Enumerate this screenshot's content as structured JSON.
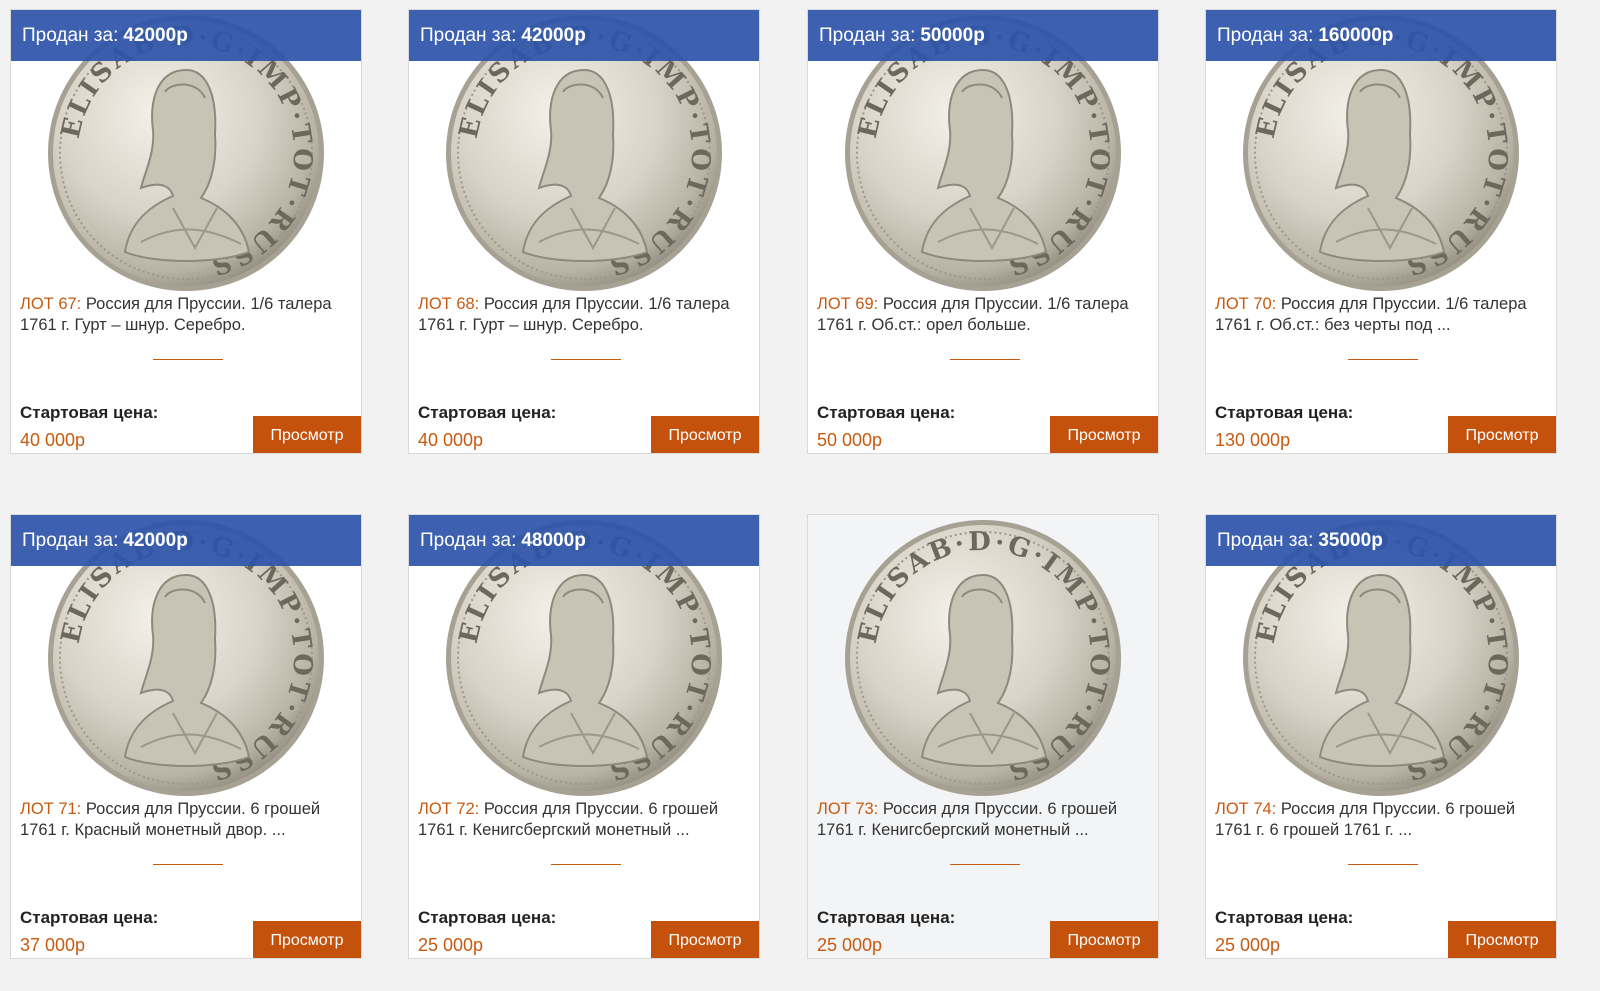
{
  "sold_prefix": "Продан за:",
  "start_label": "Стартовая цена:",
  "view_label": "Просмотр",
  "colors": {
    "sold_bar": "#2e55aa",
    "accent": "#c75a10",
    "button": "#c4510c"
  },
  "lots": [
    {
      "sold_price": "42000р",
      "lot_label": "ЛОТ 67:",
      "description": "Россия для Пруссии. 1/6 талера 1761 г. Гурт – шнур. Серебро.",
      "start_price": "40 000р",
      "coin_legend": "ELISAB·D·G·IMP·TOT·RUSS"
    },
    {
      "sold_price": "42000р",
      "lot_label": "ЛОТ 68:",
      "description": "Россия для Пруссии. 1/6 талера 1761 г. Гурт – шнур. Серебро.",
      "start_price": "40 000р",
      "coin_legend": "ELISAB·D·G·IMP·TOT·RUSS"
    },
    {
      "sold_price": "50000р",
      "lot_label": "ЛОТ 69:",
      "description": "Россия для Пруссии. 1/6 талера 1761 г. Об.ст.: орел больше.",
      "start_price": "50 000р",
      "coin_legend": "ELISAB·D·G·IMP·TOT·RUSS"
    },
    {
      "sold_price": "160000р",
      "lot_label": "ЛОТ 70:",
      "description": "Россия для Пруссии. 1/6 талера 1761 г. Об.ст.: без черты под ...",
      "start_price": "130 000р",
      "coin_legend": "ELISAB·D·G·IMP·TOT·RUSS"
    },
    {
      "sold_price": "42000р",
      "lot_label": "ЛОТ 71:",
      "description": "Россия для Пруссии. 6 грошей 1761 г. Красный монетный двор. ...",
      "start_price": "37 000р",
      "coin_legend": "ELISAB·D·G·IMP·TOT·RUSS"
    },
    {
      "sold_price": "48000р",
      "lot_label": "ЛОТ 72:",
      "description": "Россия для Пруссии. 6 грошей 1761 г. Кенигсбергский монетный ...",
      "start_price": "25 000р",
      "coin_legend": "ELISAB·D·G·IMP·TOT·RUSS"
    },
    {
      "sold_price": "",
      "lot_label": "ЛОТ 73:",
      "description": "Россия для Пруссии. 6 грошей 1761 г. Кенигсбергский монетный ...",
      "start_price": "25 000р",
      "coin_legend": "ELISAB·D·G·IMP·TOT·RUSS"
    },
    {
      "sold_price": "35000р",
      "lot_label": "ЛОТ 74:",
      "description": "Россия для Пруссии. 6 грошей 1761 г. 6 грошей 1761 г. ...",
      "start_price": "25 000р",
      "coin_legend": "ELISAB·D·G·IMP·TOT·RUSS"
    }
  ]
}
